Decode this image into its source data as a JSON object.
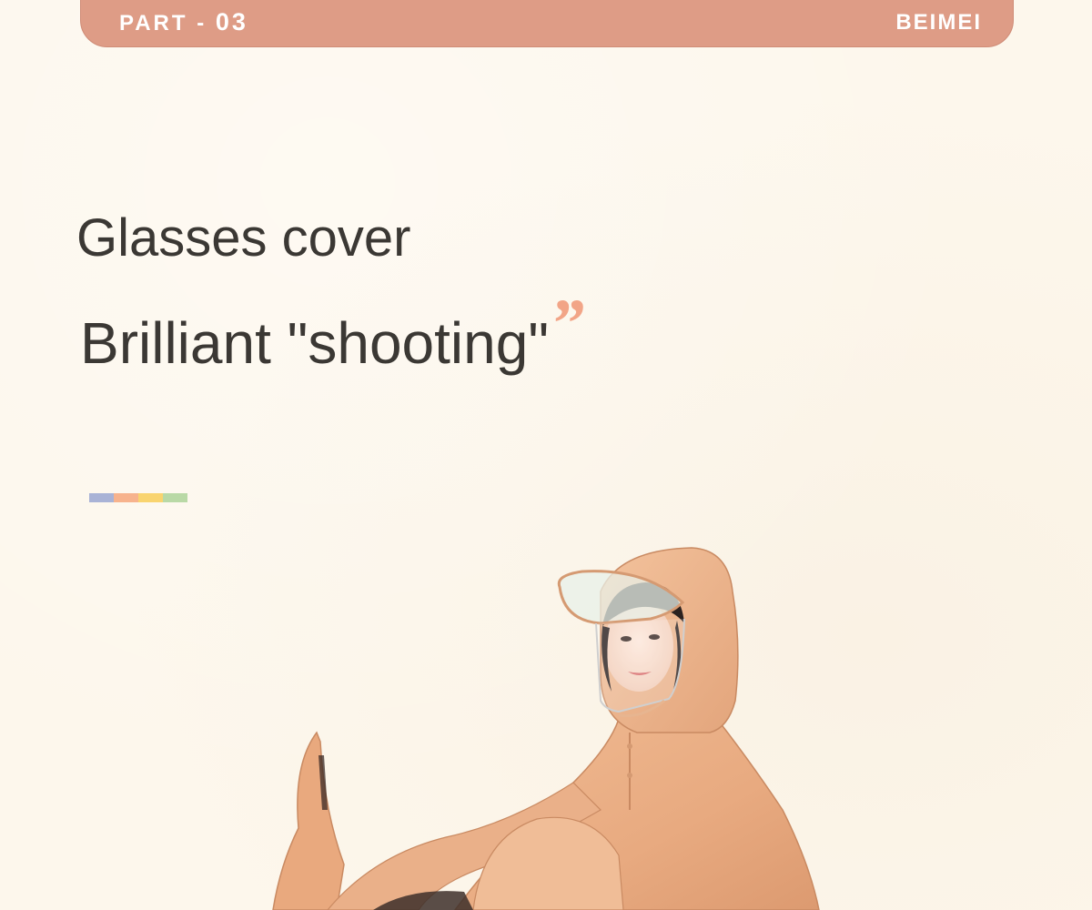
{
  "header": {
    "part_prefix": "PART - ",
    "part_number": "03",
    "brand": "BEIMEI",
    "bar_color": "#de9c86"
  },
  "headline": {
    "line1": "Glasses cover",
    "line2": "Brilliant \"shooting\"",
    "accent_quote": "”",
    "accent_color": "#f2a587"
  },
  "color_strip": {
    "colors": [
      "#a9b3d6",
      "#f7b38d",
      "#f9d46f",
      "#b9d9a6"
    ]
  },
  "product_image": {
    "subject": "woman wearing orange motorcycle raincoat with transparent face visor",
    "raincoat_color": "#eab089"
  }
}
